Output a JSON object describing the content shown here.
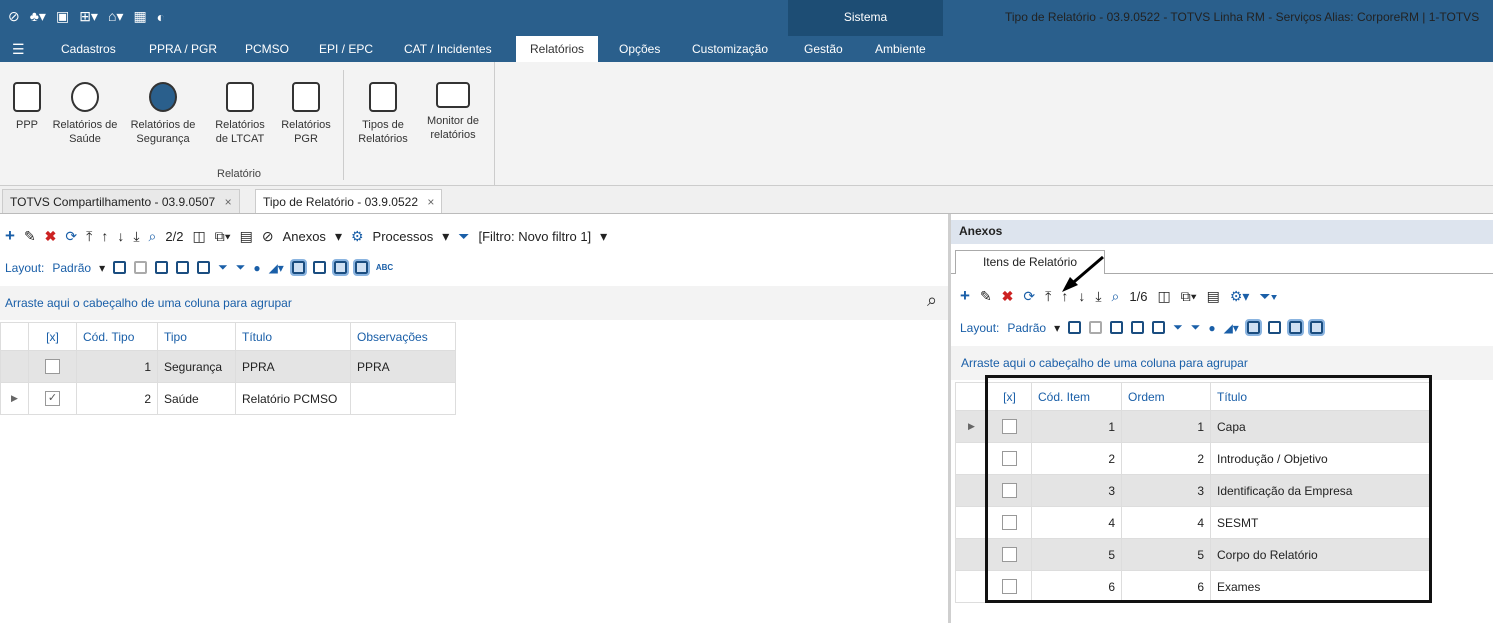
{
  "app": {
    "system_label": "Sistema",
    "window_title": "Tipo de Relatório - 03.9.0522 - TOTVS Linha RM - Serviços  Alias: CorporeRM | 1-TOTVS"
  },
  "menu": [
    "Cadastros",
    "PPRA / PGR",
    "PCMSO",
    "EPI / EPC",
    "CAT / Incidentes",
    "Relatórios",
    "Opções",
    "Customização",
    "Gestão",
    "Ambiente"
  ],
  "ribbon": {
    "buttons": [
      {
        "label": "PPP"
      },
      {
        "label": "Relatórios de Saúde"
      },
      {
        "label": "Relatórios de Segurança"
      },
      {
        "label": "Relatórios de LTCAT"
      },
      {
        "label": "Relatórios PGR"
      },
      {
        "label": "Tipos de Relatórios"
      },
      {
        "label": "Monitor de relatórios"
      }
    ],
    "group_label": "Relatório"
  },
  "doc_tabs": [
    {
      "label": "TOTVS Compartilhamento - 03.9.0507"
    },
    {
      "label": "Tipo de Relatório - 03.9.0522"
    }
  ],
  "left": {
    "record_counter": "2/2",
    "anexos_label": "Anexos",
    "processos_label": "Processos",
    "filter_label": "[Filtro: Novo filtro 1]",
    "layout_label": "Layout:",
    "layout_value": "Padrão",
    "group_hint": "Arraste aqui o cabeçalho de uma coluna para agrupar",
    "columns": [
      "[x]",
      "Cód. Tipo",
      "Tipo",
      "Título",
      "Observações"
    ],
    "rows": [
      {
        "checked": false,
        "cod": "1",
        "tipo": "Segurança",
        "titulo": "PPRA",
        "obs": "PPRA"
      },
      {
        "checked": true,
        "cod": "2",
        "tipo": "Saúde",
        "titulo": "Relatório PCMSO",
        "obs": ""
      }
    ]
  },
  "right": {
    "panel_title": "Anexos",
    "sub_tab": "Itens de Relatório",
    "record_counter": "1/6",
    "layout_label": "Layout:",
    "layout_value": "Padrão",
    "group_hint": "Arraste aqui o cabeçalho de uma coluna para agrupar",
    "columns": [
      "[x]",
      "Cód. Item",
      "Ordem",
      "Título"
    ],
    "rows": [
      {
        "cod": "1",
        "ordem": "1",
        "titulo": "Capa"
      },
      {
        "cod": "2",
        "ordem": "2",
        "titulo": "Introdução / Objetivo"
      },
      {
        "cod": "3",
        "ordem": "3",
        "titulo": "Identificação da Empresa"
      },
      {
        "cod": "4",
        "ordem": "4",
        "titulo": "SESMT"
      },
      {
        "cod": "5",
        "ordem": "5",
        "titulo": "Corpo do Relatório"
      },
      {
        "cod": "6",
        "ordem": "6",
        "titulo": "Exames"
      }
    ]
  },
  "icons": {
    "close_tab": "×",
    "dropdown": "▾",
    "search": "⌕"
  }
}
